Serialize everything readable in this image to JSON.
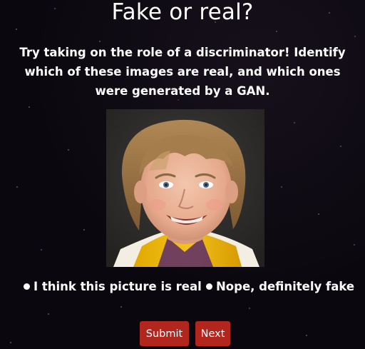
{
  "page": {
    "title": "Fake or real?",
    "subtitle": "Try taking on the role of a discriminator! Identify which of these images are real, and which ones were generated by a GAN."
  },
  "options": {
    "real_label": "I think this picture is real",
    "fake_label": "Nope, definitely fake"
  },
  "buttons": {
    "submit_label": "Submit",
    "next_label": "Next"
  },
  "colors": {
    "background": "#08060b",
    "text": "#ffffff",
    "button": "#b3261e"
  },
  "image": {
    "alt": "Portrait photo of a smiling child"
  }
}
